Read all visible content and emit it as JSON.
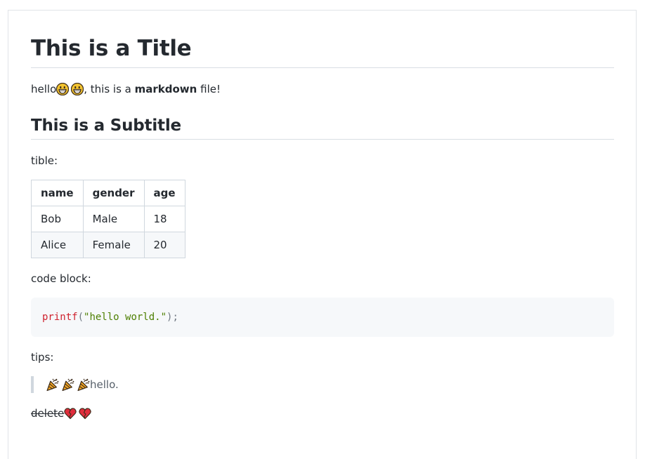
{
  "title": "This is a Title",
  "intro": {
    "before": "hello",
    "after": ", this is a ",
    "bold": "markdown",
    "end": " file!",
    "emojis": [
      "grinning-face-icon",
      "grinning-face-icon"
    ]
  },
  "subtitle": "This is a Subtitle",
  "table_caption": "tible:",
  "table": {
    "headers": [
      "name",
      "gender",
      "age"
    ],
    "rows": [
      [
        "Bob",
        "Male",
        "18"
      ],
      [
        "Alice",
        "Female",
        "20"
      ]
    ]
  },
  "code_caption": "code block:",
  "code": {
    "fn": "printf",
    "open": "(",
    "string": "\"hello world.\"",
    "close": ");"
  },
  "tips_caption": "tips:",
  "blockquote": {
    "emojis": [
      "party-popper-icon",
      "party-popper-icon",
      "party-popper-icon"
    ],
    "text": "hello."
  },
  "strikethrough": {
    "text": "delete",
    "emojis": [
      "broken-heart-icon",
      "broken-heart-icon"
    ]
  },
  "colors": {
    "text": "#24292f",
    "code_fn": "#cf222e",
    "code_string": "#4d7f00",
    "code_bg": "#f6f8fa",
    "border": "#d0d7de"
  }
}
